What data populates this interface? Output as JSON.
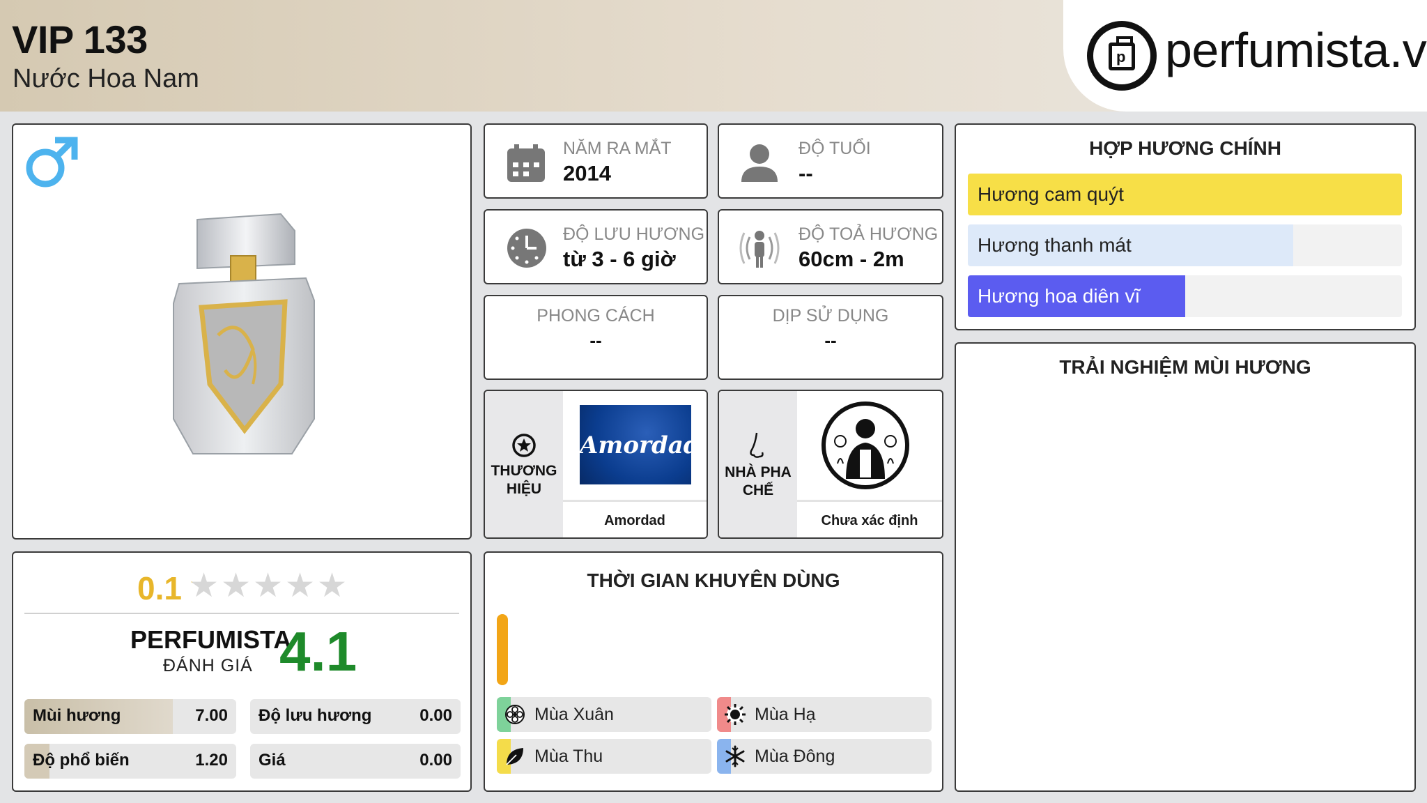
{
  "header": {
    "title": "VIP 133",
    "subtitle": "Nước Hoa Nam",
    "logo_text": "perfumista.vn"
  },
  "product": {
    "gender_icon": "male-icon",
    "image": "perfume-bottle"
  },
  "info": {
    "release_year": {
      "label": "NĂM RA MẮT",
      "value": "2014",
      "icon": "calendar-icon"
    },
    "age": {
      "label": "ĐỘ TUỔI",
      "value": "--",
      "icon": "person-icon"
    },
    "longevity": {
      "label": "ĐỘ LƯU HƯƠNG",
      "value": "từ 3 - 6 giờ",
      "icon": "clock-icon"
    },
    "sillage": {
      "label": "ĐỘ TOẢ HƯƠNG",
      "value": "60cm - 2m",
      "icon": "radiating-person-icon"
    },
    "style": {
      "label": "PHONG CÁCH",
      "value": "--"
    },
    "occasion": {
      "label": "DỊP SỬ DỤNG",
      "value": "--"
    }
  },
  "brand": {
    "label": "THƯƠNG HIỆU",
    "name": "Amordad",
    "logo_text": "Amordad",
    "icon": "star-circle-icon"
  },
  "perfumer": {
    "label": "NHÀ PHA CHẾ",
    "name": "Chưa xác định",
    "icon": "nose-icon"
  },
  "rating": {
    "user_score": "0.1",
    "stars_total": 5,
    "stars_filled": 0.1,
    "perfumista_label": "PERFUMISTA",
    "perfumista_sub": "ĐÁNH GIÁ",
    "perfumista_score": "4.1",
    "metrics": [
      {
        "label": "Mùi hương",
        "value": "7.00",
        "fraction": 0.7
      },
      {
        "label": "Độ lưu hương",
        "value": "0.00",
        "fraction": 0.0
      },
      {
        "label": "Độ phổ biến",
        "value": "1.20",
        "fraction": 0.12
      },
      {
        "label": "Giá",
        "value": "0.00",
        "fraction": 0.0
      }
    ]
  },
  "recommended_time": {
    "title": "THỜI GIAN KHUYÊN DÙNG",
    "seasons": [
      {
        "label": "Mùa Xuân",
        "icon": "flower-icon",
        "color": "#7ed29a"
      },
      {
        "label": "Mùa Hạ",
        "icon": "sun-icon",
        "color": "#f08a8a"
      },
      {
        "label": "Mùa Thu",
        "icon": "leaf-icon",
        "color": "#f4dc4a"
      },
      {
        "label": "Mùa Đông",
        "icon": "snowflake-icon",
        "color": "#8ab4ee"
      }
    ]
  },
  "accords": {
    "title": "HỢP HƯƠNG CHÍNH",
    "items": [
      {
        "label": "Hương cam quýt",
        "fraction": 1.0,
        "color": "#f7df47",
        "text_color": "#222"
      },
      {
        "label": "Hương thanh mát",
        "fraction": 0.75,
        "color": "#dde9f9",
        "text_color": "#222"
      },
      {
        "label": "Hương hoa diên vĩ",
        "fraction": 0.5,
        "color": "#5b5cf0",
        "text_color": "#ffffff"
      }
    ]
  },
  "experience": {
    "title": "TRẢI NGHIỆM MÙI HƯƠNG"
  }
}
